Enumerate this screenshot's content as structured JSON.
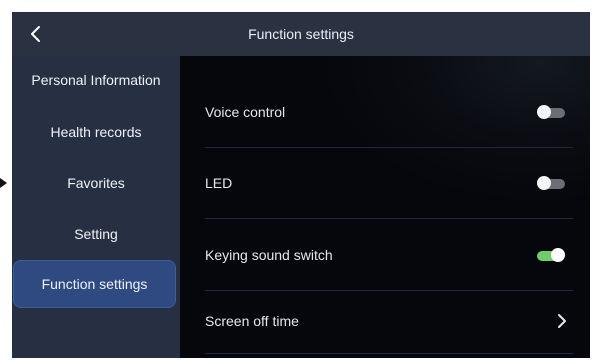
{
  "header": {
    "title": "Function settings",
    "back_icon": "chevron-left-icon"
  },
  "sidebar": {
    "items": [
      {
        "label": "Personal Information",
        "active": false
      },
      {
        "label": "Health records",
        "active": false
      },
      {
        "label": "Favorites",
        "active": false
      },
      {
        "label": "Setting",
        "active": false
      },
      {
        "label": "Function settings",
        "active": true
      }
    ]
  },
  "settings": {
    "rows": [
      {
        "label": "Voice control",
        "control": "toggle",
        "state": "off"
      },
      {
        "label": "LED",
        "control": "toggle",
        "state": "off"
      },
      {
        "label": "Keying sound switch",
        "control": "toggle",
        "state": "on"
      },
      {
        "label": "Screen off time",
        "control": "chevron",
        "icon": "chevron-right-icon"
      }
    ]
  },
  "colors": {
    "header_bg": "#2a3140",
    "sidebar_bg": "#273043",
    "active_item_bg": "#2e4a80",
    "toggle_on": "#6fcb6b",
    "toggle_off": "#6b6e75"
  }
}
